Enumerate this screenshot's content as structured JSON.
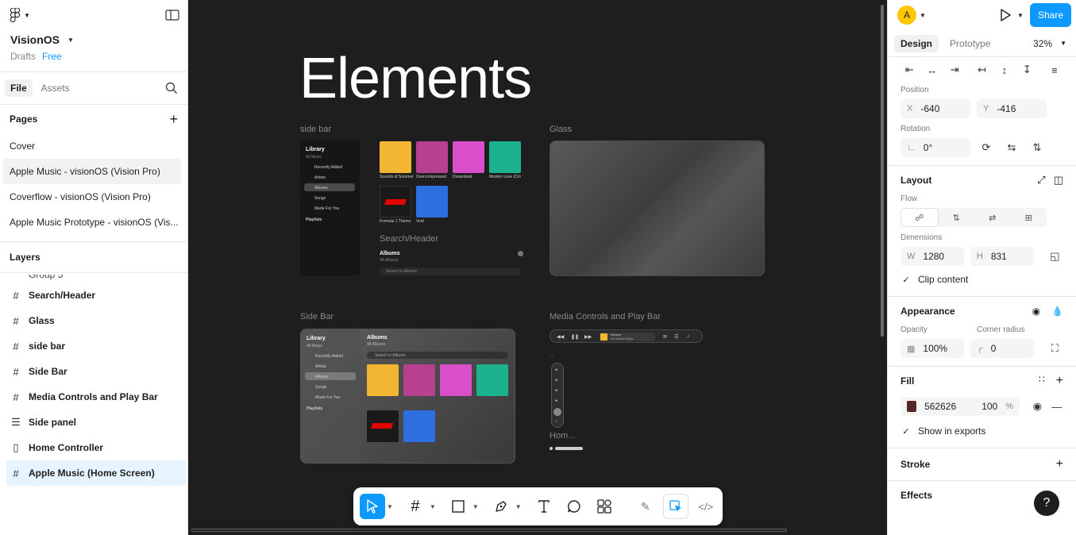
{
  "colors": {
    "accent": "#0d99ff",
    "canvas": "#1e1e1e",
    "fill_swatch": "#562626",
    "avatar": "#ffc700"
  },
  "left": {
    "project_name": "VisionOS",
    "drafts": "Drafts",
    "plan": "Free",
    "tabs": [
      "File",
      "Assets"
    ],
    "pages_title": "Pages",
    "pages": [
      "Cover",
      "Apple Music - visionOS (Vision Pro)",
      "Coverflow - visionOS (Vision Pro)",
      "Apple Music Prototype - visionOS (Vis..."
    ],
    "layers_title": "Layers",
    "layers_partial": "Group 5",
    "layers": [
      {
        "name": "Search/Header",
        "icon": "frame-icon"
      },
      {
        "name": "Glass",
        "icon": "frame-icon"
      },
      {
        "name": "side bar",
        "icon": "frame-icon"
      },
      {
        "name": "Side Bar",
        "icon": "frame-icon"
      },
      {
        "name": "Media Controls and Play Bar",
        "icon": "frame-icon"
      },
      {
        "name": "Side panel",
        "icon": "section-icon"
      },
      {
        "name": "Home Controller",
        "icon": "component-icon"
      },
      {
        "name": "Apple Music (Home Screen)",
        "icon": "frame-icon"
      }
    ]
  },
  "canvas": {
    "title": "Elements",
    "labels": {
      "side_bar": "side bar",
      "glass": "Glass",
      "side_bar_2": "Side Bar",
      "media": "Media Controls and Play Bar",
      "search_header": "Search/Header",
      "home": "Hom..."
    },
    "mini": {
      "library": "Library",
      "all_music": "All Music",
      "menu": [
        "Recently Added",
        "Artists",
        "Albums",
        "Songs",
        "Made For You"
      ],
      "playlists": "Playlists",
      "albums_title": "Albums",
      "albums_count": "48 Albums",
      "search_placeholder": "Search in Albums",
      "albums": [
        {
          "title": "Sounds of Summer",
          "artist": "The Beach Boys",
          "color": "#f2b632"
        },
        {
          "title": "Overcompressed",
          "artist": "Maxwell B.",
          "color": "#b8418f"
        },
        {
          "title": "Dreamland",
          "artist": "Glass Animals",
          "color": "#d94fc9"
        },
        {
          "title": "Modern Love (Cinema)",
          "artist": "Tomer Shechtel Dreyfus",
          "color": "#1bb38f"
        },
        {
          "title": "Formula 1 Theme",
          "artist": "Brian Tyler",
          "color": "#1a1a1a"
        },
        {
          "title": "Void",
          "artist": "Bruce",
          "color": "#2d6fe0"
        }
      ],
      "player_title": "Volcano",
      "player_artist": "The Beach Boys"
    }
  },
  "toolbar": {
    "tools": [
      "move-tool",
      "frame-tool",
      "shape-tool",
      "pen-tool",
      "text-tool",
      "comment-tool",
      "actions-tool"
    ],
    "modes": [
      "draw-mode",
      "design-mode",
      "dev-mode"
    ]
  },
  "right": {
    "share": "Share",
    "avatar_letter": "A",
    "tabs": [
      "Design",
      "Prototype"
    ],
    "zoom": "32%",
    "position_label": "Position",
    "x_label": "X",
    "x": "-640",
    "y_label": "Y",
    "y": "-416",
    "rotation_label": "Rotation",
    "rotation": "0°",
    "layout_title": "Layout",
    "flow_label": "Flow",
    "dimensions_label": "Dimensions",
    "w_label": "W",
    "w": "1280",
    "h_label": "H",
    "h": "831",
    "clip_content": "Clip content",
    "appearance_title": "Appearance",
    "opacity_label": "Opacity",
    "opacity": "100%",
    "radius_label": "Corner radius",
    "radius": "0",
    "fill_title": "Fill",
    "fill_hex": "562626",
    "fill_opacity": "100",
    "fill_pct": "%",
    "show_in_exports": "Show in exports",
    "stroke_title": "Stroke",
    "effects_title": "Effects",
    "help": "?"
  }
}
